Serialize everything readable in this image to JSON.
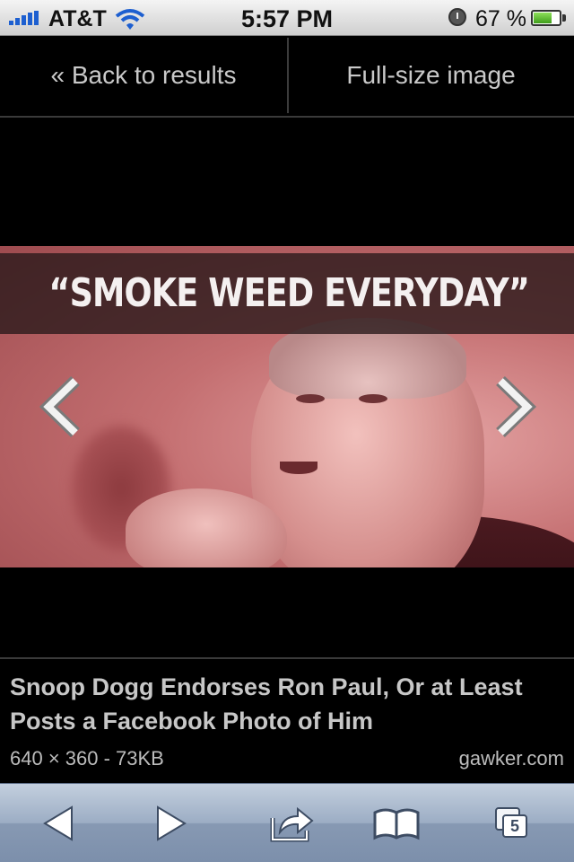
{
  "status_bar": {
    "carrier": "AT&T",
    "time": "5:57 PM",
    "battery_percent": "67 %",
    "battery_level": 0.67,
    "icons": [
      "signal-bars-icon",
      "wifi-icon",
      "alarm-icon",
      "battery-icon"
    ]
  },
  "nav": {
    "back_label": "« Back to results",
    "full_size_label": "Full-size image"
  },
  "image": {
    "caption": "“SMOKE WEED EVERYDAY”",
    "prev_icon": "chevron-left-icon",
    "next_icon": "chevron-right-icon"
  },
  "result": {
    "title": "Snoop Dogg Endorses Ron Paul, Or at Least Posts a Facebook Photo of Him",
    "meta": "640 × 360 - 73KB",
    "source": "gawker.com"
  },
  "toolbar": {
    "back_icon": "back-arrow-icon",
    "forward_icon": "forward-arrow-icon",
    "share_icon": "share-icon",
    "bookmarks_icon": "bookmarks-icon",
    "tabs_icon": "tabs-icon",
    "tabs_count": "5"
  },
  "colors": {
    "background": "#000000",
    "nav_text": "#c9c9c9",
    "toolbar": "#9cadc4",
    "image_tint": "#c46f71"
  }
}
